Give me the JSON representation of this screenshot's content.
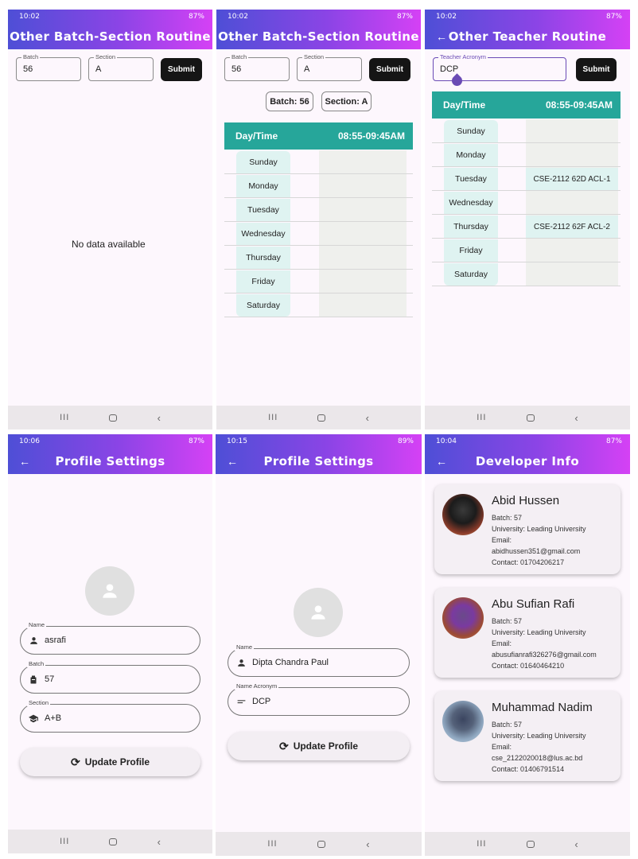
{
  "status": {
    "s1": {
      "time": "10:02",
      "battery": "87%"
    },
    "s2": {
      "time": "10:02",
      "battery": "87%"
    },
    "s3": {
      "time": "10:02",
      "battery": "87%"
    },
    "s4": {
      "time": "10:06",
      "battery": "87%"
    },
    "s5": {
      "time": "10:15",
      "battery": "89%"
    },
    "s6": {
      "time": "10:04",
      "battery": "87%"
    }
  },
  "screen1": {
    "title": "Other Batch-Section Routine",
    "batch_label": "Batch",
    "batch_value": "56",
    "section_label": "Section",
    "section_value": "A",
    "submit": "Submit",
    "empty_text": "No data available"
  },
  "screen2": {
    "title": "Other Batch-Section Routine",
    "batch_label": "Batch",
    "batch_value": "56",
    "section_label": "Section",
    "section_value": "A",
    "submit": "Submit",
    "chip_batch": "Batch: 56",
    "chip_section": "Section: A",
    "header_day": "Day/Time",
    "header_slot": "08:55-09:45AM",
    "days": [
      "Sunday",
      "Monday",
      "Tuesday",
      "Wednesday",
      "Thursday",
      "Friday",
      "Saturday"
    ]
  },
  "screen3": {
    "title": "Other Teacher Routine",
    "acronym_label": "Teacher Acronym",
    "acronym_value": "DCP",
    "submit": "Submit",
    "header_day": "Day/Time",
    "header_slot": "08:55-09:45AM",
    "days": [
      "Sunday",
      "Monday",
      "Tuesday",
      "Wednesday",
      "Thursday",
      "Friday",
      "Saturday"
    ],
    "slots": [
      "",
      "",
      "CSE-2112 62D ACL-1",
      "",
      "CSE-2112 62F ACL-2",
      "",
      ""
    ]
  },
  "screen4": {
    "title": "Profile Settings",
    "name_label": "Name",
    "name_value": "asrafi",
    "batch_label": "Batch",
    "batch_value": "57",
    "section_label": "Section",
    "section_value": "A+B",
    "update": "Update Profile"
  },
  "screen5": {
    "title": "Profile Settings",
    "name_label": "Name",
    "name_value": "Dipta Chandra Paul",
    "acronym_label": "Name Acronym",
    "acronym_value": "DCP",
    "update": "Update Profile"
  },
  "screen6": {
    "title": "Developer Info",
    "devs": [
      {
        "name": "Abid Hussen",
        "batch": "Batch: 57",
        "university": "University: Leading University",
        "email_label": "Email:",
        "email": "abidhussen351@gmail.com",
        "contact": "Contact: 01704206217"
      },
      {
        "name": "Abu Sufian Rafi",
        "batch": "Batch: 57",
        "university": "University: Leading University",
        "email_label": "Email:",
        "email": "abusufianrafi326276@gmail.com",
        "contact": "Contact: 01640464210"
      },
      {
        "name": "Muhammad Nadim",
        "batch": "Batch: 57",
        "university": "University: Leading University",
        "email_label": "Email:",
        "email": "cse_2122020018@lus.ac.bd",
        "contact": "Contact: 01406791514"
      }
    ]
  }
}
